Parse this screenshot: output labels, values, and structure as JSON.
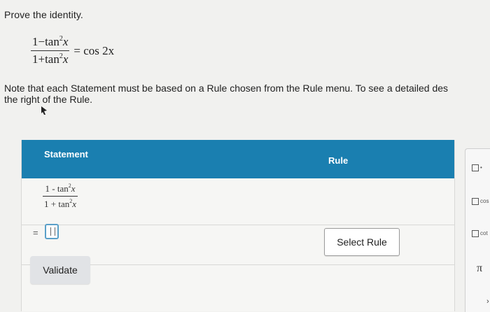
{
  "prompt": "Prove the identity.",
  "identity": {
    "numerator": "1−tan",
    "denominator": "1+tan",
    "exponent": "2",
    "variable": "x",
    "rhs": "= cos 2x"
  },
  "note": "Note that each Statement must be based on a Rule chosen from the Rule menu. To see a detailed des",
  "note_line2": "the right of the Rule.",
  "table": {
    "header_statement": "Statement",
    "header_rule": "Rule",
    "row1": {
      "numerator": "1 - tan",
      "denominator": "1 + tan",
      "exponent": "2",
      "variable": "x"
    },
    "equals": "=",
    "select_rule": "Select Rule",
    "validate": "Validate"
  },
  "side_panel": {
    "items": [
      "•",
      "cos",
      "cot"
    ],
    "pi": "π",
    "chevron": "›"
  }
}
